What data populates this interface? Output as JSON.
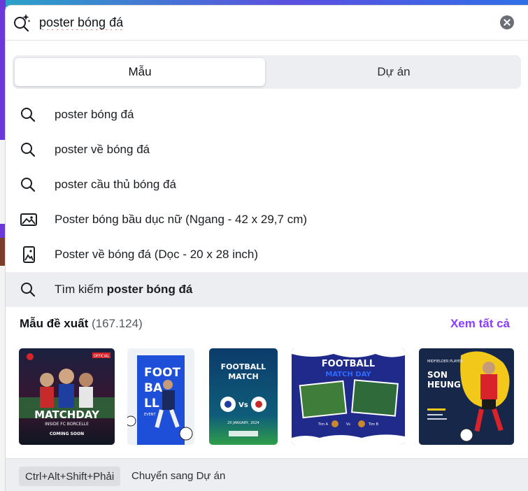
{
  "search": {
    "value": "poster bóng đá",
    "icon": "magic-search-icon"
  },
  "tabs": [
    {
      "label": "Mẫu",
      "active": true
    },
    {
      "label": "Dự án",
      "active": false
    }
  ],
  "suggestions": [
    {
      "icon": "search-icon",
      "text": "poster bóng đá"
    },
    {
      "icon": "search-icon",
      "text": "poster về bóng đá"
    },
    {
      "icon": "search-icon",
      "text": "poster cầu thủ bóng đá"
    },
    {
      "icon": "image-landscape-icon",
      "text": "Poster bóng bầu dục nữ (Ngang - 42 x 29,7 cm)"
    },
    {
      "icon": "image-portrait-icon",
      "text": "Poster về bóng đá (Dọc - 20 x 28 inch)"
    }
  ],
  "search_action": {
    "prefix": "Tìm kiếm ",
    "query": "poster bóng đá"
  },
  "templates": {
    "title": "Mẫu đề xuất",
    "count": "(167.124)",
    "see_all": "Xem tất cả",
    "items": [
      {
        "top": "OFFICIAL",
        "main": "MATCHDAY",
        "sub": "INSIDE FC BORCELLE",
        "bottom": "COMING SOON"
      },
      {
        "main": "FOOT BA LL",
        "sub": "EVENT"
      },
      {
        "main": "FOOTBALL MATCH",
        "date": "20 JANUARY, 2024",
        "teams": "Vs"
      },
      {
        "main": "FOOTBALL",
        "sub": "MATCH DAY",
        "team_a": "Tim A",
        "vs": "Vs",
        "team_b": "Tim B"
      },
      {
        "top": "MIDFIELDER PLAYER",
        "main": "SON HEUNG"
      }
    ]
  },
  "footer": {
    "shortcut": "Ctrl+Alt+Shift+Phải",
    "action": "Chuyển sang Dự án"
  },
  "colors": {
    "accent": "#8b3dff",
    "highlight": "#eceef1"
  }
}
